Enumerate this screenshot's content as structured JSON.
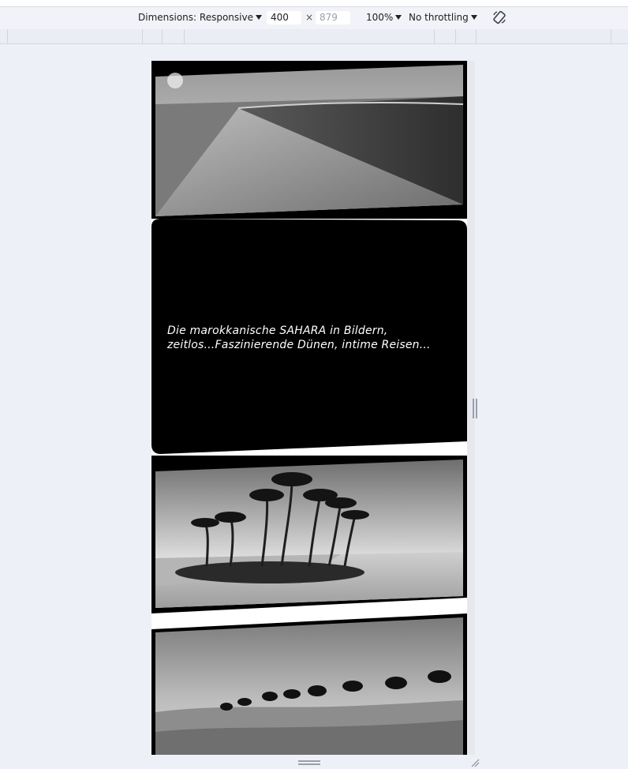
{
  "devtools": {
    "dimensions_label": "Dimensions: Responsive",
    "width_value": "400",
    "times_sign": "×",
    "height_value": "879",
    "zoom_label": "100%",
    "throttling_label": "No throttling",
    "rotate_icon": "rotate-icon"
  },
  "page": {
    "caption_line1": "Die marokkanische SAHARA in Bildern,",
    "caption_line2": "zeitlos...Faszinierende Dünen, intime Reisen...",
    "images": [
      {
        "name": "dunes-photo",
        "subject": "sand dunes"
      },
      {
        "name": "oasis-photo",
        "subject": "palm oasis"
      },
      {
        "name": "camel-caravan-photo",
        "subject": "camel caravan"
      }
    ]
  }
}
